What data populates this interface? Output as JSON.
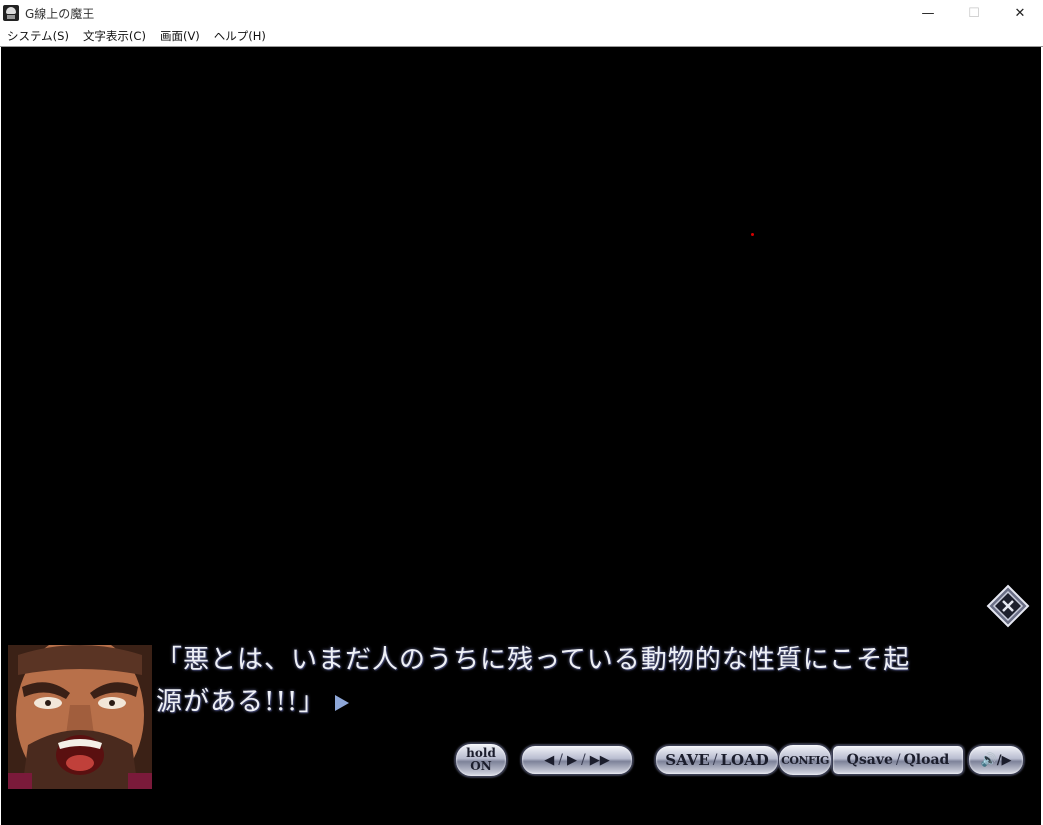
{
  "window": {
    "title": "G線上の魔王",
    "controls": {
      "minimize": "—",
      "maximize": "☐",
      "close": "✕"
    }
  },
  "menu": {
    "items": [
      "システム(S)",
      "文字表示(C)",
      "画面(V)",
      "ヘルプ(H)"
    ]
  },
  "game": {
    "background_color": "#000000",
    "dialogue": {
      "line1": "「悪とは、いまだ人のうちに残っている動物的な性質にこそ起",
      "line2": "源がある!!!」"
    },
    "hide_window_icon": "hide-window-icon",
    "controls": {
      "hold": {
        "top": "hold",
        "bottom": "ON"
      },
      "nav": {
        "back": "◀",
        "forward": "▶",
        "skip": "▶▶",
        "separator": "/"
      },
      "save": "SAVE",
      "load": "LOAD",
      "config": "CONFIG",
      "qsave": "Qsave",
      "qload": "Qload",
      "sound": "🔊/▶"
    }
  },
  "colors": {
    "dialogue_text": "#eef0f6",
    "next_arrow": "#8ea7d8",
    "button_metal": "#b9bdd0"
  }
}
